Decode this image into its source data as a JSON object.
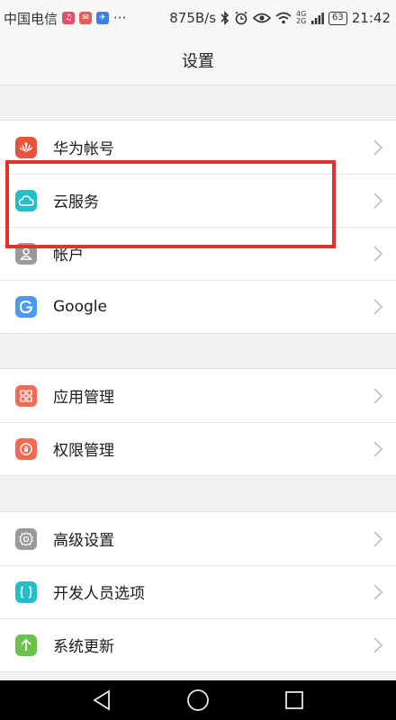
{
  "status_bar": {
    "carrier": "中国电信",
    "notification_icons": [
      {
        "icon": "music-app-icon",
        "color": "#e84c6f"
      },
      {
        "icon": "mail-app-icon",
        "color": "#e25d5d"
      },
      {
        "icon": "app-store-icon",
        "color": "#3f7de3"
      }
    ],
    "more": "···",
    "speed": "875B/s",
    "network": "4G 2G",
    "battery": "63",
    "time": "21:42"
  },
  "header": {
    "title": "设置"
  },
  "groups": [
    {
      "items": [
        {
          "label": "华为帐号",
          "icon": "huawei-icon",
          "color": "#e5533d"
        },
        {
          "label": "云服务",
          "icon": "cloud-icon",
          "color": "#27bdc8"
        },
        {
          "label": "帐户",
          "icon": "account-icon",
          "color": "#9a9a9a"
        },
        {
          "label": "Google",
          "icon": "google-icon",
          "color": "#4a9bf0"
        }
      ]
    },
    {
      "items": [
        {
          "label": "应用管理",
          "icon": "app-grid-icon",
          "color": "#f06a55"
        },
        {
          "label": "权限管理",
          "icon": "shield-icon",
          "color": "#f06a55"
        }
      ]
    },
    {
      "items": [
        {
          "label": "高级设置",
          "icon": "gear-icon",
          "color": "#9a9a9a"
        },
        {
          "label": "开发人员选项",
          "icon": "braces-icon",
          "color": "#27bdc8"
        },
        {
          "label": "系统更新",
          "icon": "arrow-up-icon",
          "color": "#6cc24a"
        }
      ]
    }
  ],
  "highlight_color": "#e3312e"
}
